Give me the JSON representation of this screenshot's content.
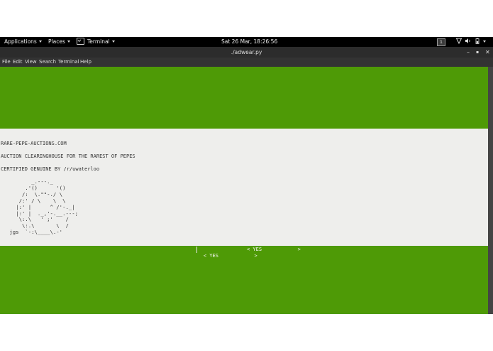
{
  "topbar": {
    "applications_label": "Applications",
    "places_label": "Places",
    "terminal_label": "Terminal",
    "clock": "Sat 26 Mar, 18:26:56",
    "workspace": "1"
  },
  "window": {
    "title": "./adwear.py",
    "minimize_glyph": "–",
    "maximize_glyph": "▪",
    "close_glyph": "✕"
  },
  "menu": {
    "items": [
      "File",
      "Edit",
      "View",
      "Search",
      "Terminal",
      "Help"
    ]
  },
  "dialog": {
    "lines": [
      "RARE-PEPE-AUCTIONS.COM",
      "AUCTION CLEARINGHOUSE FOR THE RAREST OF PEPES",
      "CERTIFIED GENUINE BY /r/uwaterloo"
    ],
    "ascii_art": "        _.---._\n      .'()      '()\n     /:  \\.\"\"-./ \\\n    /:' / \\    \\  \\\n   |:' |      ^ /'-._|\n   |:' |  ._,'-.__.---;\n    \\:.\\   ' ;'    /\n     \\:.\\       \\  /\n jgs  `-:\\____\\.-'",
    "buttons": [
      "< YES            >",
      "< YES            >"
    ]
  },
  "colors": {
    "terminal_bg": "#4e9a06",
    "dialog_bg": "#eeeeec",
    "topbar_bg": "#000000",
    "titlebar_bg": "#2c2c2c"
  }
}
